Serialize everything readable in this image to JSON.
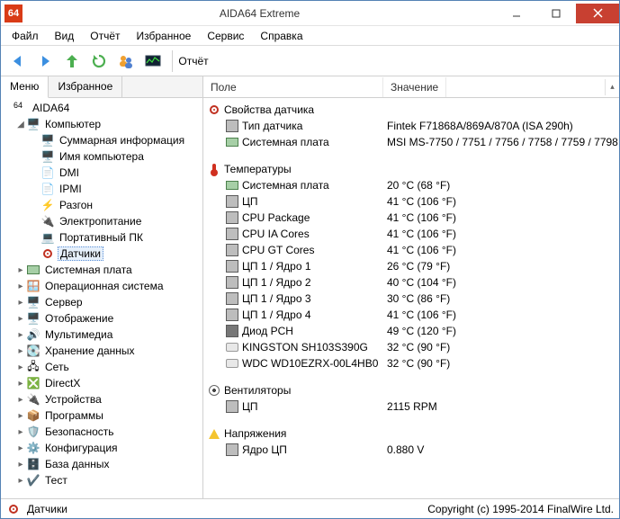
{
  "window": {
    "title": "AIDA64 Extreme",
    "app_badge": "64"
  },
  "menubar": [
    "Файл",
    "Вид",
    "Отчёт",
    "Избранное",
    "Сервис",
    "Справка"
  ],
  "toolbar": {
    "report_label": "Отчёт"
  },
  "left_tabs": {
    "menu": "Меню",
    "favorites": "Избранное"
  },
  "tree": {
    "root": "AIDA64",
    "computer": "Компьютер",
    "computer_children": [
      "Суммарная информация",
      "Имя компьютера",
      "DMI",
      "IPMI",
      "Разгон",
      "Электропитание",
      "Портативный ПК",
      "Датчики"
    ],
    "others": [
      "Системная плата",
      "Операционная система",
      "Сервер",
      "Отображение",
      "Мультимедиа",
      "Хранение данных",
      "Сеть",
      "DirectX",
      "Устройства",
      "Программы",
      "Безопасность",
      "Конфигурация",
      "База данных",
      "Тест"
    ]
  },
  "list_header": {
    "field": "Поле",
    "value": "Значение"
  },
  "groups": {
    "sensor_props": "Свойства датчика",
    "temps": "Температуры",
    "fans": "Вентиляторы",
    "volts": "Напряжения"
  },
  "sensor_props": [
    {
      "field": "Тип датчика",
      "value": "Fintek F71868A/869A/870A  (ISA 290h)"
    },
    {
      "field": "Системная плата",
      "value": "MSI MS-7750 / 7751 / 7756 / 7758 / 7759 / 7798"
    }
  ],
  "temps": [
    {
      "field": "Системная плата",
      "value": "20 °C  (68 °F)"
    },
    {
      "field": "ЦП",
      "value": "41 °C  (106 °F)"
    },
    {
      "field": "CPU Package",
      "value": "41 °C  (106 °F)"
    },
    {
      "field": "CPU IA Cores",
      "value": "41 °C  (106 °F)"
    },
    {
      "field": "CPU GT Cores",
      "value": "41 °C  (106 °F)"
    },
    {
      "field": "ЦП 1 / Ядро 1",
      "value": "26 °C  (79 °F)"
    },
    {
      "field": "ЦП 1 / Ядро 2",
      "value": "40 °C  (104 °F)"
    },
    {
      "field": "ЦП 1 / Ядро 3",
      "value": "30 °C  (86 °F)"
    },
    {
      "field": "ЦП 1 / Ядро 4",
      "value": "41 °C  (106 °F)"
    },
    {
      "field": "Диод PCH",
      "value": "49 °C  (120 °F)"
    },
    {
      "field": "KINGSTON SH103S390G",
      "value": "32 °C  (90 °F)"
    },
    {
      "field": "WDC WD10EZRX-00L4HB0",
      "value": "32 °C  (90 °F)"
    }
  ],
  "fans": [
    {
      "field": "ЦП",
      "value": "2115 RPM"
    }
  ],
  "volts": [
    {
      "field": "Ядро ЦП",
      "value": "0.880 V"
    }
  ],
  "statusbar": {
    "left": "Датчики",
    "right": "Copyright (c) 1995-2014 FinalWire Ltd."
  }
}
